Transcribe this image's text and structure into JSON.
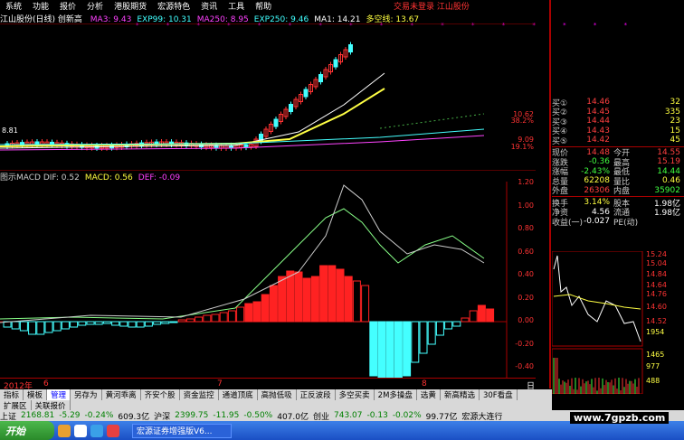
{
  "menubar": {
    "items": [
      "系统",
      "功能",
      "报价",
      "分析",
      "港股期货",
      "宏源特色",
      "资讯",
      "工具",
      "帮助"
    ],
    "status_text": "交易未登录   江山股份"
  },
  "main_title": "江山股份(日线) 创新高",
  "ma_indicators": [
    {
      "label": "MA3: 9.43",
      "color": "#ff40ff"
    },
    {
      "label": "EXP99: 10.31",
      "color": "#40ffff"
    },
    {
      "label": "MA250: 8.95",
      "color": "#ff40ff"
    },
    {
      "label": "EXP250: 9.46",
      "color": "#40ffff"
    },
    {
      "label": "MA1: 14.21",
      "color": "#ffffff"
    },
    {
      "label": "多空线: 13.67",
      "color": "#ffff40"
    }
  ],
  "stars": "* * * * * * * * * * * * * * * * *",
  "left_value_marker": "8.81",
  "right_axis_upper": [
    "10.62",
    "38.2%",
    "9.09",
    "19.1%"
  ],
  "macd_header": [
    {
      "label": "图示MACD  DIF: 0.52",
      "color": "#cccccc"
    },
    {
      "label": "MACD: 0.56",
      "color": "#ffff40"
    },
    {
      "label": "DEF: -0.09",
      "color": "#ff40ff"
    }
  ],
  "macd_axis": [
    "1.20",
    "1.00",
    "0.80",
    "0.60",
    "0.40",
    "0.20",
    "0.00",
    "-0.20",
    "-0.40"
  ],
  "date_row": {
    "year": "2012年",
    "m6": "6",
    "m7": "7",
    "m8": "8",
    "period": "日线"
  },
  "quote_panel": {
    "bids": [
      {
        "label": "买①",
        "price": "14.46",
        "vol": "32"
      },
      {
        "label": "买②",
        "price": "14.45",
        "vol": "335"
      },
      {
        "label": "买③",
        "price": "14.44",
        "vol": "23"
      },
      {
        "label": "买④",
        "price": "14.43",
        "vol": "15"
      },
      {
        "label": "买⑤",
        "price": "14.42",
        "vol": "45"
      }
    ],
    "stats": [
      {
        "l1": "现价",
        "v1": "14.48",
        "l2": "今开",
        "v2": "14.55",
        "c1": "#ff4040",
        "c2": "#ff4040"
      },
      {
        "l1": "涨跌",
        "v1": "-0.36",
        "l2": "最高",
        "v2": "15.19",
        "c1": "#40ff40",
        "c2": "#ff4040"
      },
      {
        "l1": "涨幅",
        "v1": "-2.43%",
        "l2": "最低",
        "v2": "14.44",
        "c1": "#40ff40",
        "c2": "#40ff40"
      },
      {
        "l1": "总量",
        "v1": "62208",
        "l2": "量比",
        "v2": "0.46",
        "c1": "#ffff40",
        "c2": "#ffff40"
      },
      {
        "l1": "外盘",
        "v1": "26306",
        "l2": "内盘",
        "v2": "35902",
        "c1": "#ff4040",
        "c2": "#40ff40"
      }
    ],
    "stats2": [
      {
        "l1": "换手",
        "v1": "3.14%",
        "l2": "股本",
        "v2": "1.98亿",
        "c1": "#ffff40",
        "c2": "#ffffff"
      },
      {
        "l1": "净资",
        "v1": "4.56",
        "l2": "流通",
        "v2": "1.98亿",
        "c1": "#ffffff",
        "c2": "#ffffff"
      },
      {
        "l1": "收益(一)",
        "v1": "-0.027",
        "l2": "PE(动)",
        "v2": "",
        "c1": "#ffffff",
        "c2": "#ffffff"
      }
    ]
  },
  "mini_axis": [
    "15.24",
    "15.04",
    "14.84",
    "14.64",
    "14.76",
    "14.60",
    "14.52",
    "1954",
    "1465",
    "977",
    "488"
  ],
  "tabs": [
    "指标",
    "模板",
    "管理",
    "另存为",
    "黄河乖离",
    "齐安个股",
    "资金监控",
    "通道顶底",
    "高抛低吸",
    "正反波段",
    "多空买卖",
    "2M多操盘",
    "选黄",
    "新高精选",
    "30F看盘"
  ],
  "active_tab": "管理",
  "subtabs": [
    "扩展区",
    "关联报价"
  ],
  "ticker": [
    {
      "t": "上证",
      "c": "#000000"
    },
    {
      "t": "2168.81",
      "c": "#008000"
    },
    {
      "t": "-5.29",
      "c": "#008000"
    },
    {
      "t": "-0.24%",
      "c": "#008000"
    },
    {
      "t": "609.3亿",
      "c": "#000000"
    },
    {
      "t": "沪深",
      "c": "#000000"
    },
    {
      "t": "2399.75",
      "c": "#008000"
    },
    {
      "t": "-11.95",
      "c": "#008000"
    },
    {
      "t": "-0.50%",
      "c": "#008000"
    },
    {
      "t": "407.0亿",
      "c": "#000000"
    },
    {
      "t": "创业",
      "c": "#000000"
    },
    {
      "t": "743.07",
      "c": "#008000"
    },
    {
      "t": "-0.13",
      "c": "#008000"
    },
    {
      "t": "-0.02%",
      "c": "#008000"
    },
    {
      "t": "99.77亿",
      "c": "#000000"
    },
    {
      "t": "宏源大连行",
      "c": "#000000"
    }
  ],
  "taskbar": {
    "start": "开始",
    "task": "宏源证券增强版V6..."
  },
  "watermark": "www.7gpzb.com"
}
